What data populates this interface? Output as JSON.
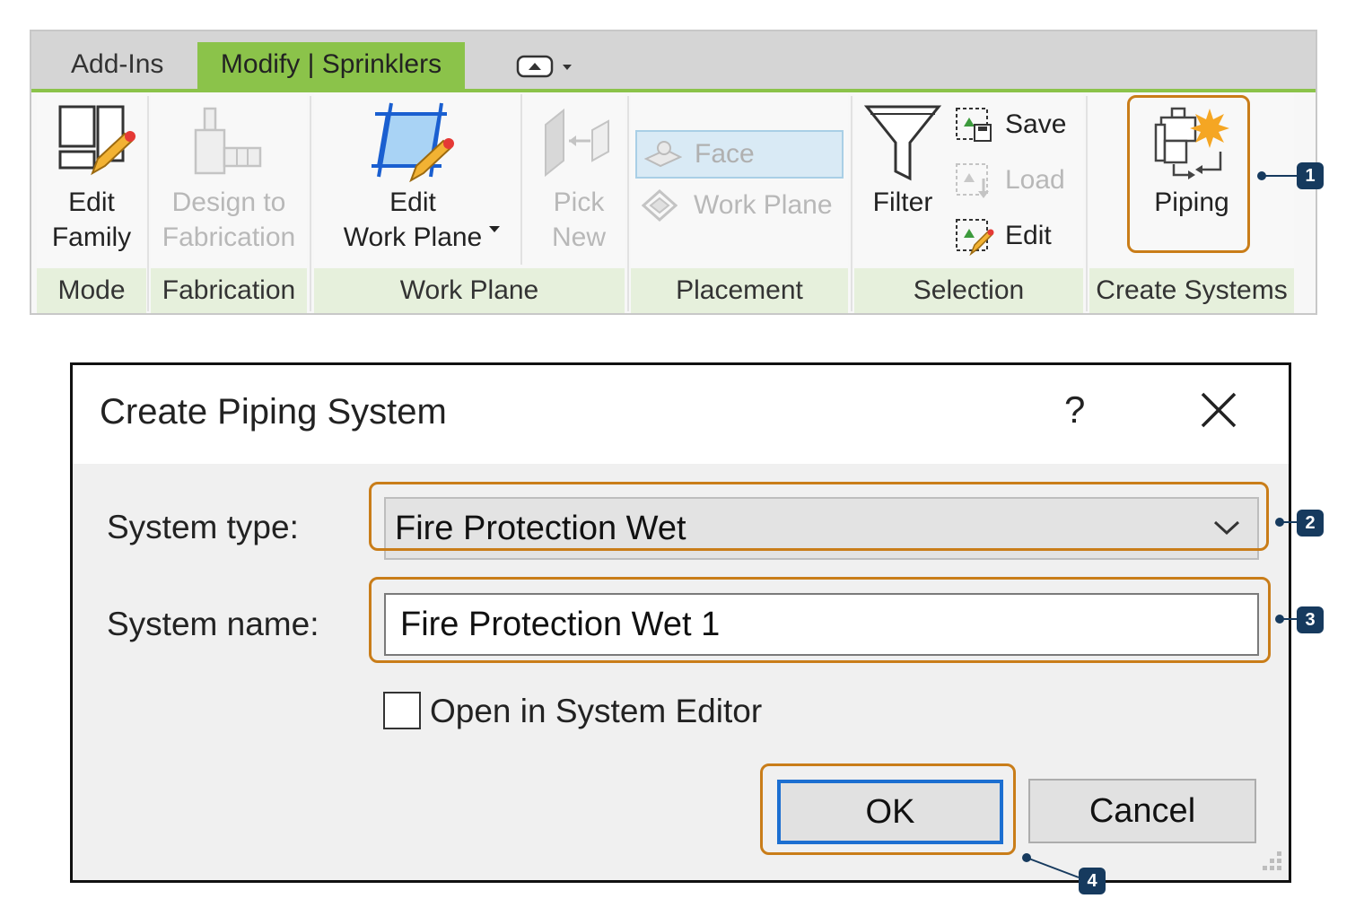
{
  "ribbon": {
    "tabs": [
      "Add-Ins",
      "Modify | Sprinklers"
    ],
    "active_tab": "Modify | Sprinklers",
    "accent_color": "#8bc34a",
    "panels": {
      "mode": {
        "label": "Mode",
        "buttons": [
          {
            "line1": "Edit",
            "line2": "Family",
            "icon": "edit-family-icon"
          }
        ]
      },
      "fabrication": {
        "label": "Fabrication",
        "buttons": [
          {
            "line1": "Design to",
            "line2": "Fabrication",
            "icon": "design-to-fabrication-icon",
            "enabled": false
          }
        ]
      },
      "work_plane": {
        "label": "Work Plane",
        "buttons": [
          {
            "line1": "Edit",
            "line2": "Work Plane",
            "icon": "edit-work-plane-icon"
          },
          {
            "line1": "Pick",
            "line2": "New",
            "icon": "pick-new-icon",
            "enabled": false
          }
        ]
      },
      "placement": {
        "label": "Placement",
        "face": "Face",
        "work_plane": "Work Plane"
      },
      "selection": {
        "label": "Selection",
        "filter": "Filter",
        "save": "Save",
        "load": "Load",
        "edit": "Edit"
      },
      "create_systems": {
        "label": "Create Systems",
        "piping": "Piping",
        "icon": "piping-system-icon"
      }
    }
  },
  "dialog": {
    "title": "Create Piping System",
    "help": "?",
    "system_type_label": "System type:",
    "system_type_value": "Fire Protection Wet",
    "system_name_label": "System name:",
    "system_name_value": "Fire Protection Wet 1",
    "open_in_editor_label": "Open in System Editor",
    "open_in_editor_checked": false,
    "ok_label": "OK",
    "cancel_label": "Cancel"
  },
  "callouts": [
    "1",
    "2",
    "3",
    "4"
  ],
  "highlight_color": "#c97d19",
  "callout_color": "#163a5e"
}
